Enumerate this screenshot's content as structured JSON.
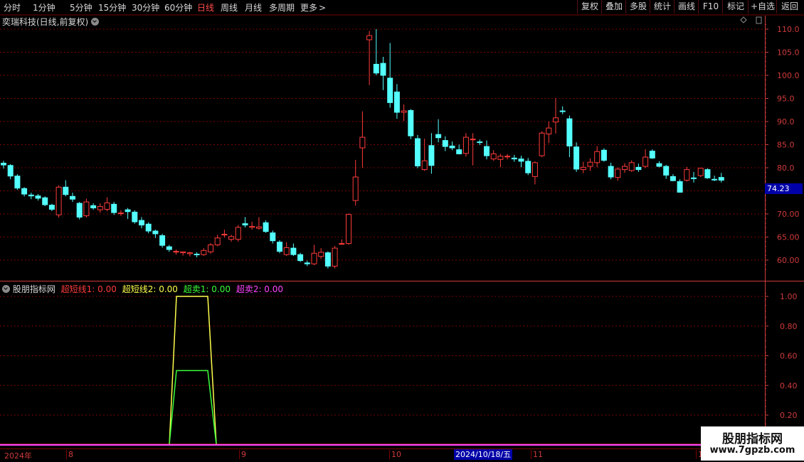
{
  "toolbar": {
    "periods": [
      "分时",
      "1分钟",
      "5分钟",
      "15分钟",
      "30分钟",
      "60分钟",
      "日线",
      "周线",
      "月线",
      "多周期",
      "更多"
    ],
    "active_period": "日线",
    "more_arrow": ">",
    "right_buttons": [
      "复权",
      "叠加",
      "多股",
      "统计",
      "画线",
      "F10",
      "标记",
      "+自选",
      "返回"
    ]
  },
  "main_chart": {
    "title": "奕瑞科技(日线,前复权)",
    "price_axis": [
      "110.0",
      "105.0",
      "100.0",
      "95.0",
      "90.0",
      "85.0",
      "80.0",
      "75.0",
      "70.00",
      "65.00",
      "60.00"
    ],
    "current_price": "74.23"
  },
  "indicator": {
    "name": "股朋指标网",
    "legend": [
      {
        "label": "超短线1: 0.00",
        "color": "#ff3b3b"
      },
      {
        "label": "超短线2: 0.00",
        "color": "#ffff4d"
      },
      {
        "label": "超卖1: 0.00",
        "color": "#3bff3b"
      },
      {
        "label": "超卖2: 0.00",
        "color": "#ff44ff"
      }
    ],
    "axis": [
      "1.00",
      "0.80",
      "0.60",
      "0.40",
      "0.20"
    ]
  },
  "date_axis": {
    "labels": [
      "2024年",
      "8",
      "9",
      "10",
      "11",
      "1"
    ],
    "cursor_date": "2024/10/18/五"
  },
  "watermark": {
    "title": "股朋指标网",
    "url": "www.7gpzb.com"
  },
  "colors": {
    "up": "#ff3b3b",
    "down": "#54ffff",
    "grid": "#7a0000",
    "axis": "#cf3a3a",
    "bg": "#000000"
  },
  "chart_data": {
    "type": "candlestick",
    "price_ylim": [
      56,
      112
    ],
    "ohlc": [
      [
        81.0,
        81.5,
        79.8,
        80.6
      ],
      [
        80.5,
        80.8,
        77.5,
        78.2
      ],
      [
        78.2,
        78.6,
        75.2,
        75.6
      ],
      [
        75.5,
        75.8,
        73.8,
        74.3
      ],
      [
        74.1,
        74.6,
        73.2,
        73.9
      ],
      [
        73.9,
        74.3,
        72.9,
        73.4
      ],
      [
        73.5,
        73.8,
        71.7,
        72.0
      ],
      [
        71.9,
        72.2,
        70.6,
        71.0
      ],
      [
        69.8,
        76.2,
        69.2,
        75.8
      ],
      [
        75.8,
        77.3,
        73.8,
        74.2
      ],
      [
        73.8,
        74.6,
        72.6,
        73.2
      ],
      [
        72.3,
        72.6,
        68.8,
        69.3
      ],
      [
        69.6,
        73.3,
        69.2,
        72.6
      ],
      [
        71.8,
        72.3,
        70.9,
        71.3
      ],
      [
        70.9,
        72.3,
        70.3,
        71.6
      ],
      [
        71.0,
        73.6,
        70.6,
        72.4
      ],
      [
        72.1,
        72.6,
        69.8,
        70.3
      ],
      [
        70.2,
        70.8,
        69.6,
        70.2
      ],
      [
        70.9,
        71.3,
        68.9,
        70.5
      ],
      [
        70.4,
        70.8,
        67.9,
        68.3
      ],
      [
        68.6,
        69.3,
        66.9,
        67.6
      ],
      [
        67.8,
        68.2,
        65.8,
        66.3
      ],
      [
        66.3,
        66.6,
        64.8,
        65.7
      ],
      [
        65.3,
        65.7,
        62.7,
        63.2
      ],
      [
        62.9,
        63.3,
        61.8,
        62.3
      ],
      [
        61.9,
        62.3,
        61.2,
        61.9
      ],
      [
        61.6,
        61.9,
        61.0,
        61.8
      ],
      [
        61.4,
        61.8,
        60.8,
        61.6
      ],
      [
        61.3,
        61.7,
        60.6,
        61.2
      ],
      [
        61.2,
        62.6,
        60.9,
        62.1
      ],
      [
        61.8,
        63.7,
        61.4,
        63.3
      ],
      [
        63.3,
        65.5,
        63.0,
        64.8
      ],
      [
        65.6,
        66.6,
        64.9,
        65.6
      ],
      [
        64.5,
        65.5,
        64.0,
        65.1
      ],
      [
        64.5,
        67.6,
        64.0,
        67.1
      ],
      [
        67.9,
        69.3,
        67.1,
        67.6
      ],
      [
        67.1,
        68.3,
        66.6,
        67.3
      ],
      [
        66.9,
        69.3,
        66.6,
        67.2
      ],
      [
        68.1,
        68.6,
        65.9,
        66.2
      ],
      [
        65.9,
        66.4,
        63.6,
        64.2
      ],
      [
        63.9,
        64.3,
        61.5,
        61.9
      ],
      [
        61.2,
        63.9,
        60.9,
        62.7
      ],
      [
        62.6,
        63.6,
        60.9,
        61.2
      ],
      [
        61.2,
        61.6,
        59.6,
        59.9
      ],
      [
        59.4,
        59.9,
        58.7,
        59.2
      ],
      [
        59.2,
        63.3,
        58.9,
        61.5
      ],
      [
        60.8,
        62.6,
        60.3,
        61.7
      ],
      [
        61.6,
        61.9,
        58.2,
        58.7
      ],
      [
        58.7,
        63.1,
        58.2,
        62.6
      ],
      [
        63.6,
        64.5,
        63.3,
        63.6
      ],
      [
        63.6,
        70.1,
        63.3,
        69.9
      ],
      [
        72.9,
        81.7,
        71.8,
        78.0
      ],
      [
        84.3,
        92.2,
        80.0,
        86.6
      ],
      [
        107.7,
        109.6,
        97.9,
        108.6
      ],
      [
        102.4,
        110.0,
        100.0,
        100.5
      ],
      [
        102.6,
        104.0,
        96.8,
        100.0
      ],
      [
        99.4,
        107.0,
        93.0,
        94.1
      ],
      [
        96.4,
        98.1,
        90.6,
        92.0
      ],
      [
        92.0,
        93.7,
        90.1,
        92.3
      ],
      [
        92.4,
        92.7,
        86.2,
        86.9
      ],
      [
        86.3,
        87.1,
        79.9,
        80.4
      ],
      [
        79.6,
        86.3,
        79.3,
        81.5
      ],
      [
        84.8,
        87.5,
        78.7,
        80.5
      ],
      [
        87.2,
        90.5,
        85.5,
        86.5
      ],
      [
        85.9,
        86.8,
        83.6,
        84.6
      ],
      [
        84.7,
        85.7,
        83.8,
        84.3
      ],
      [
        83.9,
        85.0,
        82.9,
        83.0
      ],
      [
        83.1,
        87.5,
        82.4,
        86.6
      ],
      [
        86.2,
        87.5,
        80.5,
        86.2
      ],
      [
        85.6,
        86.1,
        84.9,
        85.5
      ],
      [
        84.6,
        85.9,
        81.8,
        82.6
      ],
      [
        81.9,
        83.8,
        81.5,
        83.0
      ],
      [
        81.8,
        83.0,
        80.1,
        82.5
      ],
      [
        82.4,
        83.0,
        81.8,
        82.5
      ],
      [
        82.1,
        82.8,
        81.3,
        81.9
      ],
      [
        81.9,
        82.6,
        80.1,
        81.4
      ],
      [
        81.4,
        82.1,
        78.4,
        78.9
      ],
      [
        78.1,
        81.4,
        76.4,
        81.1
      ],
      [
        82.6,
        87.9,
        82.3,
        87.5
      ],
      [
        87.3,
        90.0,
        85.3,
        88.6
      ],
      [
        89.9,
        95.1,
        87.4,
        90.8
      ],
      [
        92.3,
        93.3,
        91.6,
        92.2
      ],
      [
        90.6,
        91.3,
        82.3,
        84.7
      ],
      [
        84.5,
        85.5,
        79.1,
        79.7
      ],
      [
        79.6,
        81.3,
        78.8,
        80.1
      ],
      [
        80.3,
        82.0,
        79.3,
        81.2
      ],
      [
        81.1,
        84.7,
        80.1,
        83.5
      ],
      [
        83.8,
        84.2,
        81.3,
        81.6
      ],
      [
        80.3,
        81.1,
        77.5,
        78.0
      ],
      [
        77.9,
        80.1,
        77.2,
        79.7
      ],
      [
        79.6,
        81.0,
        78.9,
        80.3
      ],
      [
        79.4,
        81.6,
        79.1,
        81.1
      ],
      [
        80.1,
        80.9,
        79.1,
        79.6
      ],
      [
        80.3,
        84.0,
        79.9,
        82.3
      ],
      [
        83.6,
        84.0,
        81.9,
        82.1
      ],
      [
        80.9,
        81.4,
        80.1,
        80.3
      ],
      [
        80.3,
        80.6,
        77.6,
        78.4
      ],
      [
        78.1,
        78.6,
        77.1,
        77.2
      ],
      [
        77.0,
        77.5,
        74.6,
        74.7
      ],
      [
        77.3,
        80.2,
        77.0,
        79.6
      ],
      [
        77.8,
        79.1,
        76.8,
        77.7
      ],
      [
        78.3,
        80.0,
        78.0,
        79.9
      ],
      [
        79.6,
        79.9,
        77.6,
        77.8
      ],
      [
        77.5,
        78.3,
        77.1,
        77.4
      ],
      [
        77.9,
        78.9,
        76.8,
        77.3
      ]
    ],
    "indicator": {
      "ylim": [
        0,
        1.15
      ],
      "series": [
        {
          "name": "超短线1",
          "values_all_zero": true
        },
        {
          "name": "超短线2",
          "segment_start": 20,
          "segment_end": 25,
          "shape": [
            0,
            1,
            1,
            1,
            1,
            0
          ]
        },
        {
          "name": "超卖1",
          "segment_start": 20,
          "segment_end": 25,
          "shape": [
            0,
            0.5,
            0.5,
            0.5,
            0.5,
            0
          ]
        },
        {
          "name": "超卖2",
          "values_all_zero": true
        }
      ]
    }
  }
}
